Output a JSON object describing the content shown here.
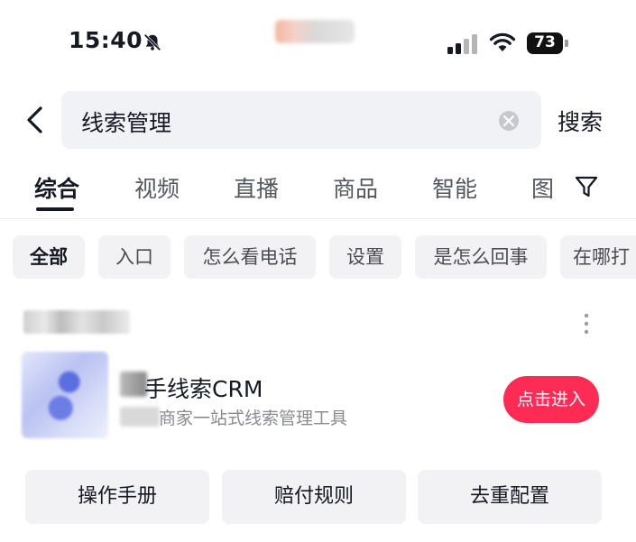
{
  "status_bar": {
    "time": "15:40",
    "battery": "73"
  },
  "search": {
    "query": "线索管理",
    "button_label": "搜索"
  },
  "tabs": [
    {
      "label": "综合"
    },
    {
      "label": "视频"
    },
    {
      "label": "直播"
    },
    {
      "label": "商品"
    },
    {
      "label": "智能"
    },
    {
      "label": "图"
    }
  ],
  "chips": [
    {
      "label": "全部"
    },
    {
      "label": "入口"
    },
    {
      "label": "怎么看电话"
    },
    {
      "label": "设置"
    },
    {
      "label": "是怎么回事"
    },
    {
      "label": "在哪打"
    }
  ],
  "app_card": {
    "name": "手线索CRM",
    "description": "商家一站式线索管理工具",
    "enter_label": "点击进入"
  },
  "actions": [
    {
      "label": "操作手册"
    },
    {
      "label": "赔付规则"
    },
    {
      "label": "去重配置"
    }
  ],
  "colors": {
    "accent": "#fe2c55",
    "chip_bg": "#f2f2f4",
    "search_bg": "#f1f2f5"
  },
  "icons": [
    "bell-muted-icon",
    "cellular-signal-icon",
    "wifi-icon",
    "battery-icon",
    "back-arrow-icon",
    "clear-icon",
    "filter-icon",
    "more-vertical-icon"
  ]
}
